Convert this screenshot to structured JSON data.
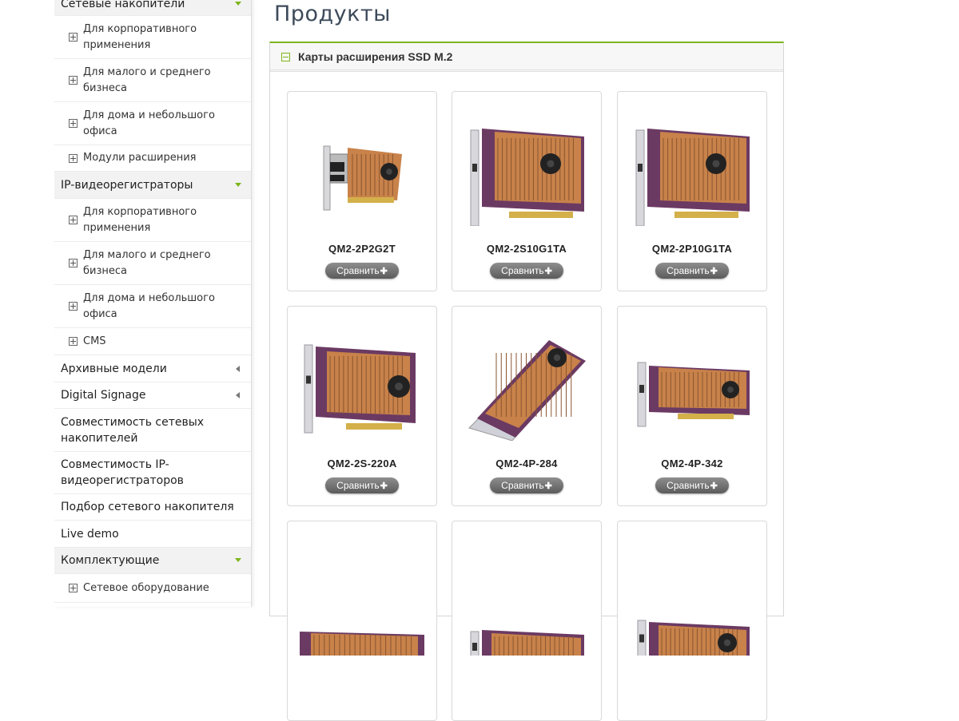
{
  "sidebar": {
    "nas_category": "Сетевые накопители",
    "nas_items": [
      {
        "line1": "Для корпоративного",
        "line2": "применения"
      },
      {
        "line1": "Для малого и среднего",
        "line2": "бизнеса"
      },
      {
        "line1": "Для дома и небольшого",
        "line2": "офиса"
      },
      {
        "line1": "Модули расширения",
        "line2": ""
      }
    ],
    "nvr_category": "IP-видеорегистраторы",
    "nvr_items": [
      {
        "line1": "Для корпоративного",
        "line2": "применения"
      },
      {
        "line1": "Для малого и среднего",
        "line2": "бизнеса"
      },
      {
        "line1": "Для дома и небольшого",
        "line2": "офиса"
      },
      {
        "line1": "CMS",
        "line2": ""
      }
    ],
    "archive": "Архивные модели",
    "signage": "Digital Signage",
    "nas_compat": {
      "line1": "Совместимость сетевых",
      "line2": "накопителей"
    },
    "nvr_compat": {
      "line1": "Совместимость IP-",
      "line2": "видеорегистраторов"
    },
    "nas_picker": "Подбор сетевого накопителя",
    "live_demo": "Live demo",
    "accessories": "Комплектующие",
    "network_equipment": "Сетевое оборудование"
  },
  "main": {
    "title": "Продукты",
    "panel_title": "Карты расширения SSD M.2",
    "compare_label": "Сравнить",
    "compare_plus": "✚",
    "products": [
      {
        "name": "QM2-2P2G2T"
      },
      {
        "name": "QM2-2S10G1TA"
      },
      {
        "name": "QM2-2P10G1TA"
      },
      {
        "name": "QM2-2S-220A"
      },
      {
        "name": "QM2-4P-284"
      },
      {
        "name": "QM2-4P-342"
      },
      {
        "name": ""
      },
      {
        "name": ""
      },
      {
        "name": ""
      }
    ]
  },
  "colors": {
    "accent": "#7db51c",
    "heatsink": "#c8824a",
    "pcb": "#6b3a63"
  }
}
